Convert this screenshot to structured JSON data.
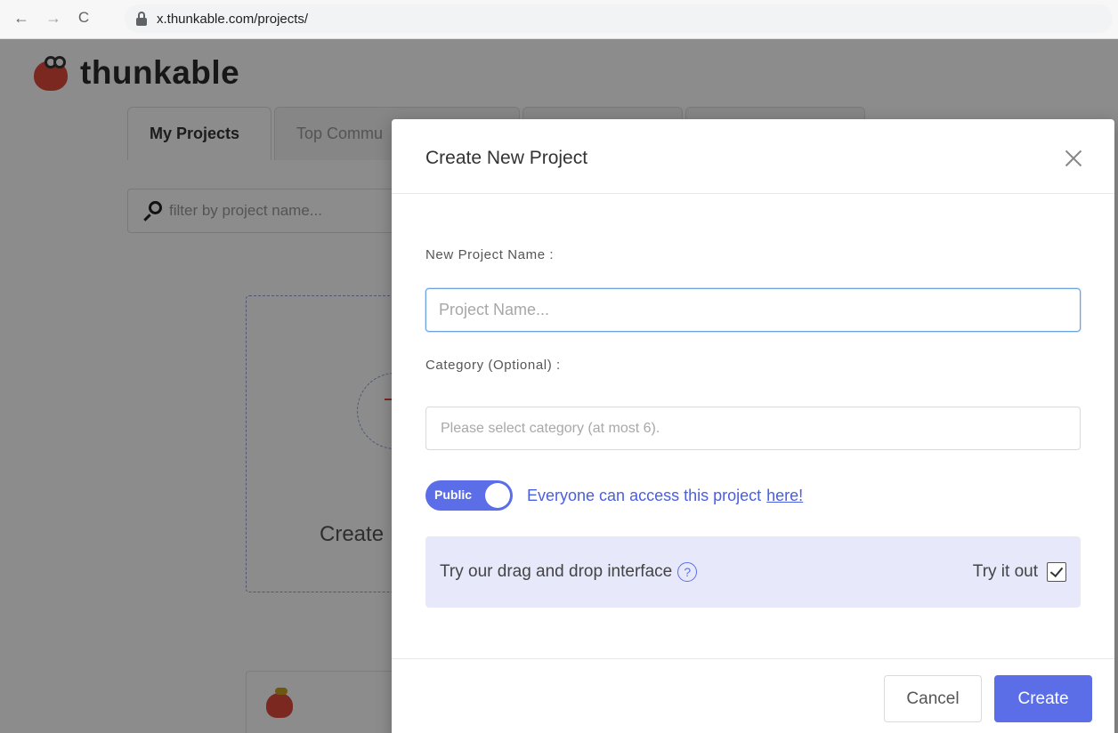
{
  "browser": {
    "url": "x.thunkable.com/projects/",
    "back_icon": "←",
    "forward_icon": "→",
    "reload_icon": "C"
  },
  "app": {
    "brand": "thunkable",
    "tabs": [
      {
        "label": "My Projects"
      },
      {
        "label": "Top Commu"
      },
      {
        "label": ""
      },
      {
        "label": ""
      }
    ],
    "filter_placeholder": "filter by project name...",
    "create_card_label": "Create I"
  },
  "modal": {
    "title": "Create New Project",
    "name_label": "New Project Name :",
    "name_placeholder": "Project Name...",
    "category_label": "Category (Optional) :",
    "category_placeholder": "Please select category (at most 6).",
    "toggle_label": "Public",
    "toggle_on": true,
    "access_text": "Everyone can access this project",
    "access_link": "here!",
    "dnd_text": "Try our drag and drop interface",
    "help_icon": "?",
    "try_label": "Try it out",
    "try_checked": true,
    "cancel_label": "Cancel",
    "create_label": "Create"
  },
  "colors": {
    "accent": "#5b6ee8",
    "brand_red": "#e0493c",
    "panel_bg": "#e7e9fb"
  }
}
